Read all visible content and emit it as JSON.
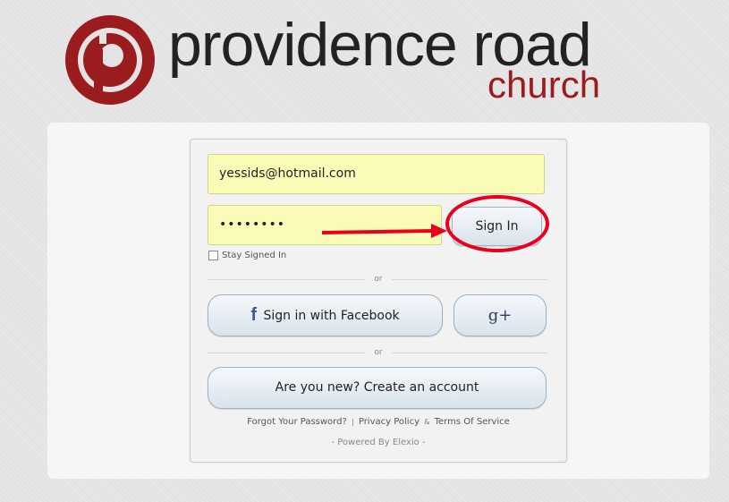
{
  "logo": {
    "main_text": "providence road",
    "sub_text": "church",
    "brand_color": "#9b1c1f",
    "icon": "providence-road-logo-icon"
  },
  "login": {
    "email_value": "yessids@hotmail.com",
    "password_mask": "••••••••",
    "sign_in_label": "Sign In",
    "stay_signed_in_label": "Stay Signed In",
    "or_label_1": "or",
    "facebook_label": "Sign in with Facebook",
    "facebook_icon": "f",
    "google_plus_label": "g+",
    "or_label_2": "or",
    "create_account_label": "Are you new?  Create an account",
    "forgot_password_label": "Forgot Your Password?",
    "separator": "|",
    "privacy_label": "Privacy Policy",
    "ampersand": "&",
    "terms_label": "Terms Of Service",
    "powered_by": "- Powered By Elexio -"
  },
  "annotation": {
    "color": "#e8001c"
  }
}
